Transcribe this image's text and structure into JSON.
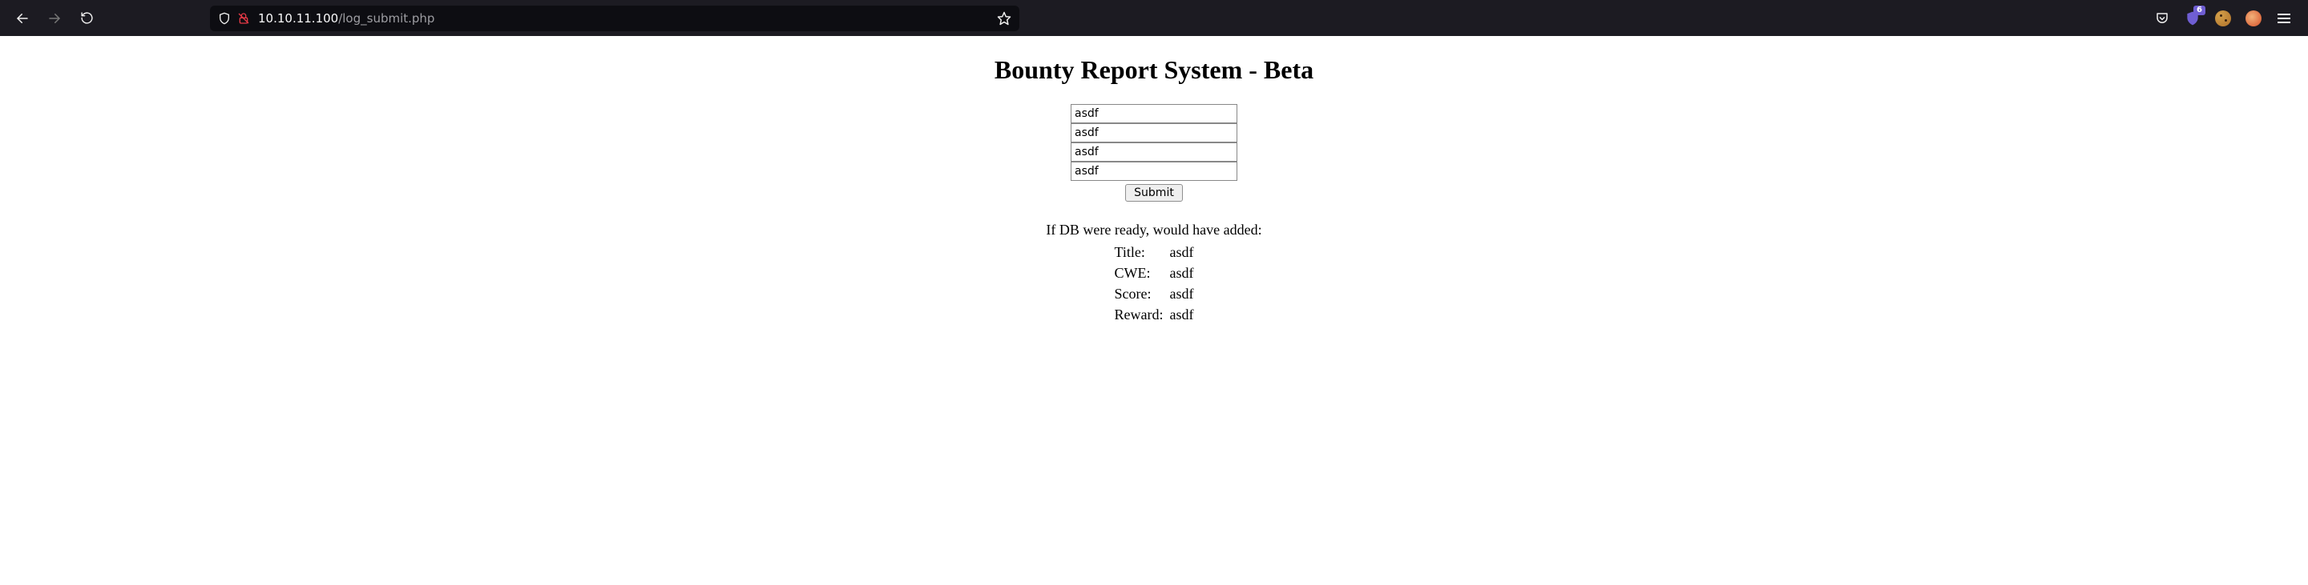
{
  "browser": {
    "url_host": "10.10.11.100",
    "url_path": "/log_submit.php",
    "notif_badge": "6"
  },
  "page": {
    "title": "Bounty Report System - Beta",
    "form": {
      "field1": "asdf",
      "field2": "asdf",
      "field3": "asdf",
      "field4": "asdf",
      "submit_label": "Submit"
    },
    "result": {
      "heading": "If DB were ready, would have added:",
      "rows": [
        {
          "label": "Title:",
          "value": "asdf"
        },
        {
          "label": "CWE:",
          "value": "asdf"
        },
        {
          "label": "Score:",
          "value": "asdf"
        },
        {
          "label": "Reward:",
          "value": "asdf"
        }
      ]
    }
  }
}
